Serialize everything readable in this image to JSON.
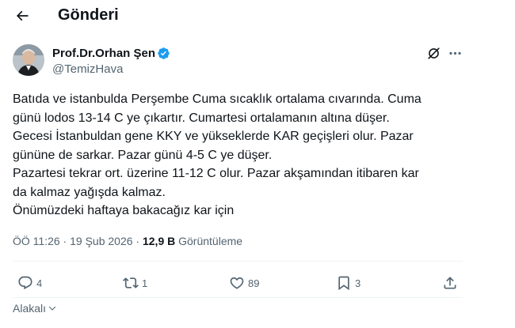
{
  "header": {
    "back_icon": "arrow-left-icon",
    "title": "Gönderi"
  },
  "author": {
    "name": "Prof.Dr.Orhan Şen",
    "handle": "@TemizHava",
    "verified": true,
    "verified_color": "#1d9bf0",
    "avatar_icon": "profile-photo"
  },
  "tweet": {
    "lines": [
      "Batıda ve istanbulda Perşembe Cuma sıcaklık ortalama cıvarında.  Cuma",
      "günü lodos 13-14 C ye çıkartır. Cumartesi ortalamanın altına düşer.",
      "Gecesi İstanbuldan gene KKY ve yükseklerde KAR geçişleri olur. Pazar",
      "gününe de sarkar. Pazar günü 4-5 C ye düşer.",
      "Pazartesi tekrar ort. üzerine 11-12 C olur. Pazar akşamından itibaren kar",
      "da kalmaz yağışda kalmaz.",
      "Önümüzdeki haftaya bakacağız kar için"
    ]
  },
  "meta": {
    "time": "ÖÖ 11:26",
    "separator": " · ",
    "date": "19 Şub 2026",
    "views_count": "12,9 B",
    "views_label": " Görüntüleme"
  },
  "actions": {
    "replies": "4",
    "reposts": "1",
    "likes": "89",
    "bookmarks": "3"
  },
  "related": {
    "label": "Alakalı"
  },
  "colors": {
    "text": "#0f1419",
    "secondary": "#536471",
    "divider": "#eff3f4",
    "accent": "#1d9bf0"
  }
}
